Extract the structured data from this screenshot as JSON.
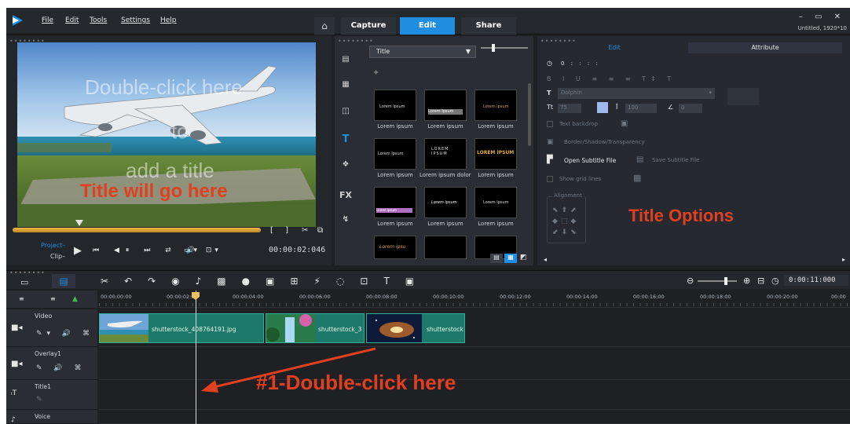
{
  "menu": [
    "File",
    "Edit",
    "Tools",
    "Settings",
    "Help"
  ],
  "tabs": [
    {
      "label": "Capture"
    },
    {
      "label": "Edit",
      "active": true
    },
    {
      "label": "Share"
    }
  ],
  "window": {
    "title": "Untitled, 1920*10",
    "controls": "– ▭ ✕"
  },
  "preview": {
    "overlay_lines": [
      "Double-click here",
      "to",
      "add a title"
    ],
    "annotation": "Title will go here",
    "project_label": "Project–",
    "clip_label": "Clip–",
    "timecode": "00:00:02:046"
  },
  "library": {
    "dropdown": "Title",
    "sidebar": [
      "T",
      "FX"
    ],
    "items": [
      {
        "label": "Lorem ipsum",
        "inner": "Lorem Ipsum"
      },
      {
        "label": "Lorem ipsum",
        "inner": "Lorem Ipsum"
      },
      {
        "label": "Lorem ipsum",
        "inner": "Lorem ipsum"
      },
      {
        "label": "Lorem ipsum",
        "inner": "Lorem Ipsum"
      },
      {
        "label": "Lorem ipsum dolor ...",
        "inner": "LOREM IPSUM"
      },
      {
        "label": "Lorem ipsum",
        "inner": "LOREM IPSUM"
      },
      {
        "label": "Lorem ipsum",
        "inner": "Lorem ipsum"
      },
      {
        "label": "Lorem ipsum",
        "inner": "Lorem ipsum"
      },
      {
        "label": "Lorem ipsum",
        "inner": "Lorem Ipsum"
      },
      {
        "label": "",
        "inner": "Lorem ipsu"
      },
      {
        "label": "",
        "inner": ""
      },
      {
        "label": "",
        "inner": ""
      }
    ]
  },
  "options": {
    "tabs": [
      "Edit",
      "Attribute"
    ],
    "time": "0 : : : :",
    "font": "Dolphin",
    "size": "75",
    "line_spacing": "100",
    "angle": "0",
    "text_backdrop": "Text backdrop",
    "border": "Border/Shadow/Transparency",
    "open_subtitle": "Open Subtitle File",
    "save_subtitle": "Save Subtitle File",
    "grid_lines": "Show grid lines",
    "alignment": "Alignment",
    "annotation": "Title Options"
  },
  "timeline": {
    "timecode": "0:00:11:000",
    "ticks": [
      "00:00:00:00",
      "00:00:02:00",
      "00:00:04:00",
      "00:00:06:00",
      "00:00:08:00",
      "00:00:10:00",
      "00:00:12:00",
      "00:00:14:00",
      "00:00:16:00",
      "00:00:18:00",
      "00:00:20:00",
      "00:00"
    ],
    "tracks": [
      {
        "name": "Video"
      },
      {
        "name": "Overlay1"
      },
      {
        "name": "Title1"
      },
      {
        "name": "Voice"
      }
    ],
    "clips": [
      {
        "label": "shutterstock_408764191.jpg"
      },
      {
        "label": "shutterstock_3"
      },
      {
        "label": "shutterstock"
      }
    ],
    "annotation": "#1-Double-click here"
  }
}
